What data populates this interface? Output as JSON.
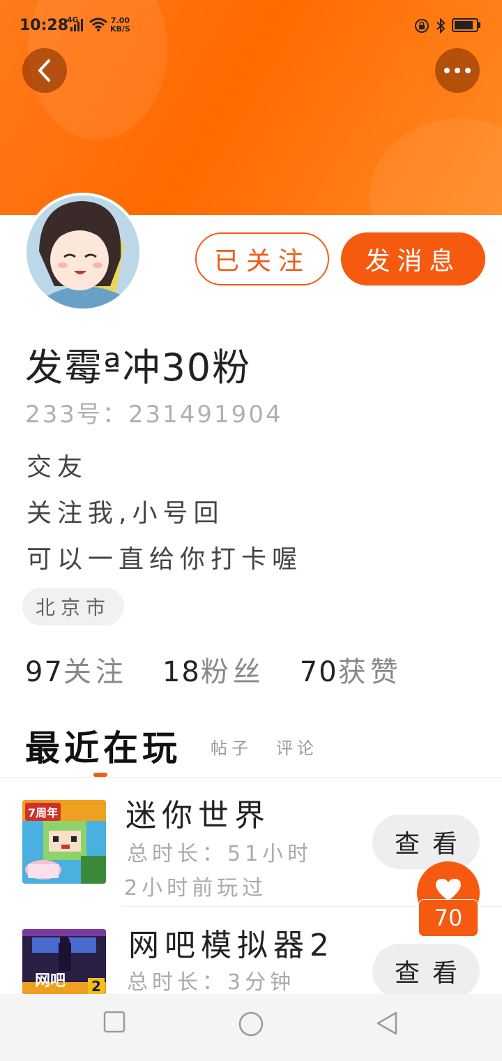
{
  "status_bar": {
    "time": "10:28",
    "network": "4G",
    "speed_value": "7.00",
    "speed_unit": "KB/S"
  },
  "header": {
    "back_icon": "chevron-left-icon",
    "more_icon": "more-dots-icon"
  },
  "profile": {
    "avatar_icon": "anime-avatar",
    "follow_button": "已关注",
    "message_button": "发消息",
    "name": "发霉ª冲30粉",
    "uid": "233号：231491904",
    "bio": [
      "交友",
      "关注我,小号回",
      "可以一直给你打卡喔"
    ],
    "location": "北京市"
  },
  "stats": {
    "following_count": "97",
    "following_label": "关注",
    "fans_count": "18",
    "fans_label": "粉丝",
    "likes_count": "70",
    "likes_label": "获赞"
  },
  "tabs": {
    "active": "最近在玩",
    "posts": "帖子",
    "comments": "评论"
  },
  "games": [
    {
      "title": "迷你世界",
      "total_time": "总时长：51小时",
      "last_played": "2小时前玩过",
      "view_button": "查看",
      "thumb_badge": "7周年"
    },
    {
      "title": "网吧模拟器2",
      "total_time": "总时长：3分钟",
      "view_button": "查看",
      "thumb_text": "网吧",
      "thumb_badge": "2"
    }
  ],
  "like_fab": {
    "icon": "heart-icon",
    "count": "70"
  },
  "colors": {
    "accent": "#f55a10",
    "header": "#ff6a00"
  }
}
